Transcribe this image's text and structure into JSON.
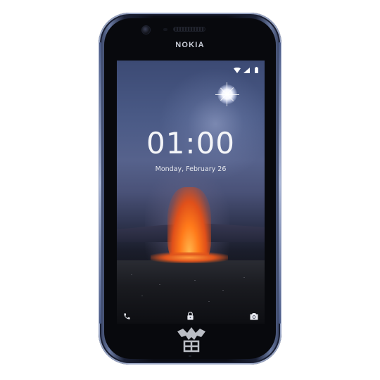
{
  "device": {
    "brand": "NOKIA"
  },
  "lockscreen": {
    "time": "01:00",
    "date": "Monday, February 26"
  },
  "status_bar": {
    "icons": [
      "wifi-icon",
      "signal-icon",
      "battery-icon"
    ]
  },
  "shortcuts": {
    "icons": [
      "phone-icon",
      "lock-icon",
      "camera-icon"
    ]
  },
  "colors": {
    "bezel": "#0b0d14",
    "frame_accent": "#6b7ba3",
    "lava": "#ff7a1a",
    "text": "#f4f5f8"
  }
}
